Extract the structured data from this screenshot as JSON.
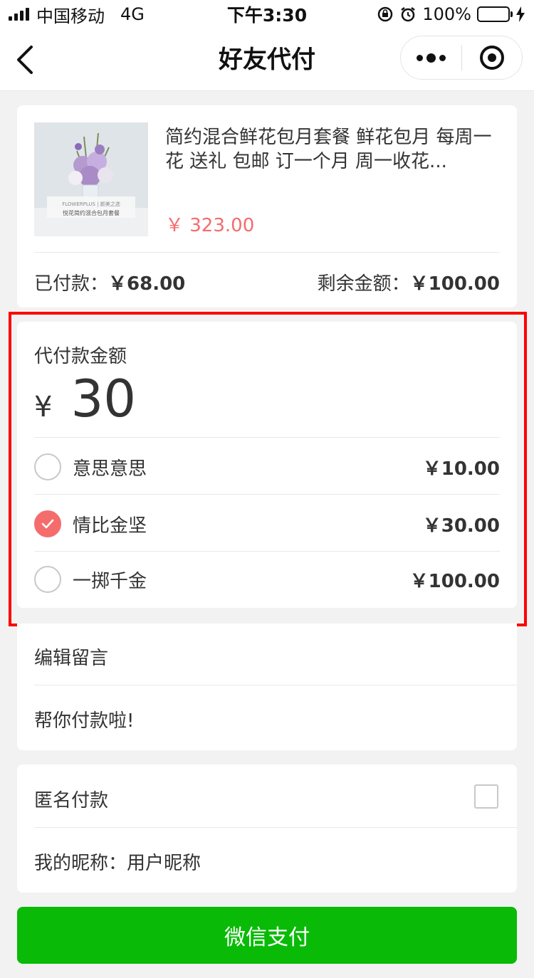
{
  "status_bar": {
    "carrier": "中国移动",
    "network": "4G",
    "time": "下午3:30",
    "battery": "100%"
  },
  "nav": {
    "title": "好友代付"
  },
  "product": {
    "title": "简约混合鲜花包月套餐 鲜花包月 每周一花 送礼 包邮 订一个月 周一收花...",
    "price": "￥ 323.00",
    "image_caption_1": "FLOWERPLUS | 颜美之选",
    "image_caption_2": "悦花简约混合包月套餐",
    "paid_label": "已付款：",
    "paid_value": "￥68.00",
    "remain_label": "剩余金额：",
    "remain_value": "￥100.00"
  },
  "amount": {
    "label": "代付款金额",
    "currency": "¥",
    "value": "30",
    "options": [
      {
        "label": "意思意思",
        "price": "￥10.00",
        "selected": false
      },
      {
        "label": "情比金坚",
        "price": "￥30.00",
        "selected": true
      },
      {
        "label": "一掷千金",
        "price": "￥100.00",
        "selected": false
      }
    ]
  },
  "message": {
    "title": "编辑留言",
    "text": "帮你付款啦!"
  },
  "anonymous": {
    "label": "匿名付款",
    "nickname_label": "我的昵称：",
    "nickname_value": "用户昵称"
  },
  "pay_button": {
    "label": "微信支付",
    "color": "#09bb07"
  },
  "colors": {
    "accent_red": "#f56c6c",
    "highlight_box": "#ff0000"
  }
}
